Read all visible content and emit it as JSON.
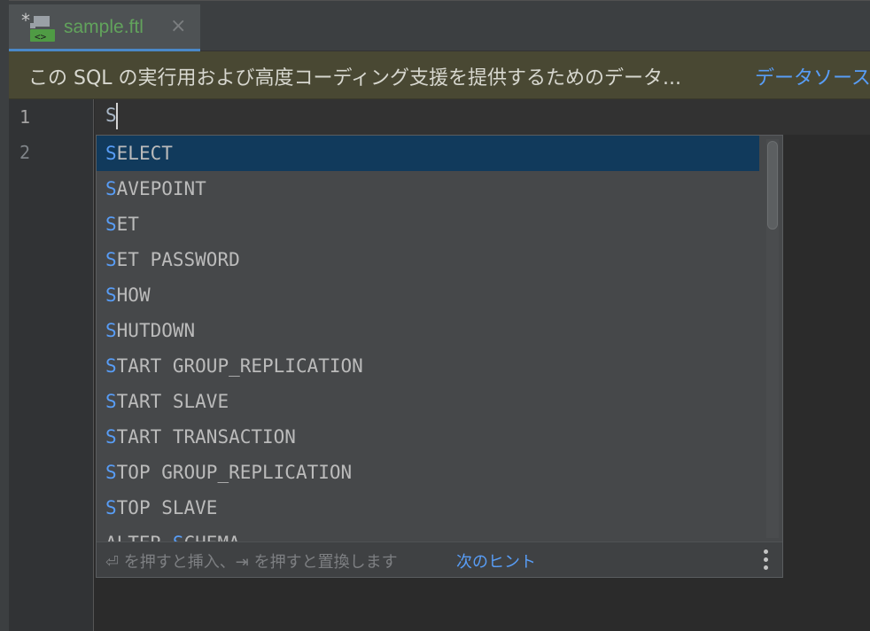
{
  "tab": {
    "modified_marker": "*",
    "file_name": "sample.ftl",
    "close_symbol": "×",
    "icon": "ftl-file-icon"
  },
  "banner": {
    "message": "この SQL の実行用および高度コーディング支援を提供するためのデータ...",
    "link": "データソース"
  },
  "editor": {
    "line_numbers": [
      "1",
      "2"
    ],
    "line1_text": "S"
  },
  "completion": {
    "typed_prefix": "S",
    "items": [
      {
        "match": "S",
        "rest": "ELECT"
      },
      {
        "match": "S",
        "rest": "AVEPOINT"
      },
      {
        "match": "S",
        "rest": "ET"
      },
      {
        "match": "S",
        "rest": "ET PASSWORD"
      },
      {
        "match": "S",
        "rest": "HOW"
      },
      {
        "match": "S",
        "rest": "HUTDOWN"
      },
      {
        "match": "S",
        "rest": "TART GROUP_REPLICATION"
      },
      {
        "match": "S",
        "rest": "TART SLAVE"
      },
      {
        "match": "S",
        "rest": "TART TRANSACTION"
      },
      {
        "match": "S",
        "rest": "TOP GROUP_REPLICATION"
      },
      {
        "match": "S",
        "rest": "TOP SLAVE"
      },
      {
        "prefix": "ALTER ",
        "match": "S",
        "rest": "CHEMA"
      }
    ],
    "selected_index": 0,
    "footer_hint": "⏎ を押すと挿入、⇥ を押すと置換します",
    "footer_link": "次のヒント",
    "more_icon": "more-vertical-icon"
  },
  "colors": {
    "accent": "#589df6",
    "selection": "#113a5c",
    "file_green": "#62a35c"
  }
}
